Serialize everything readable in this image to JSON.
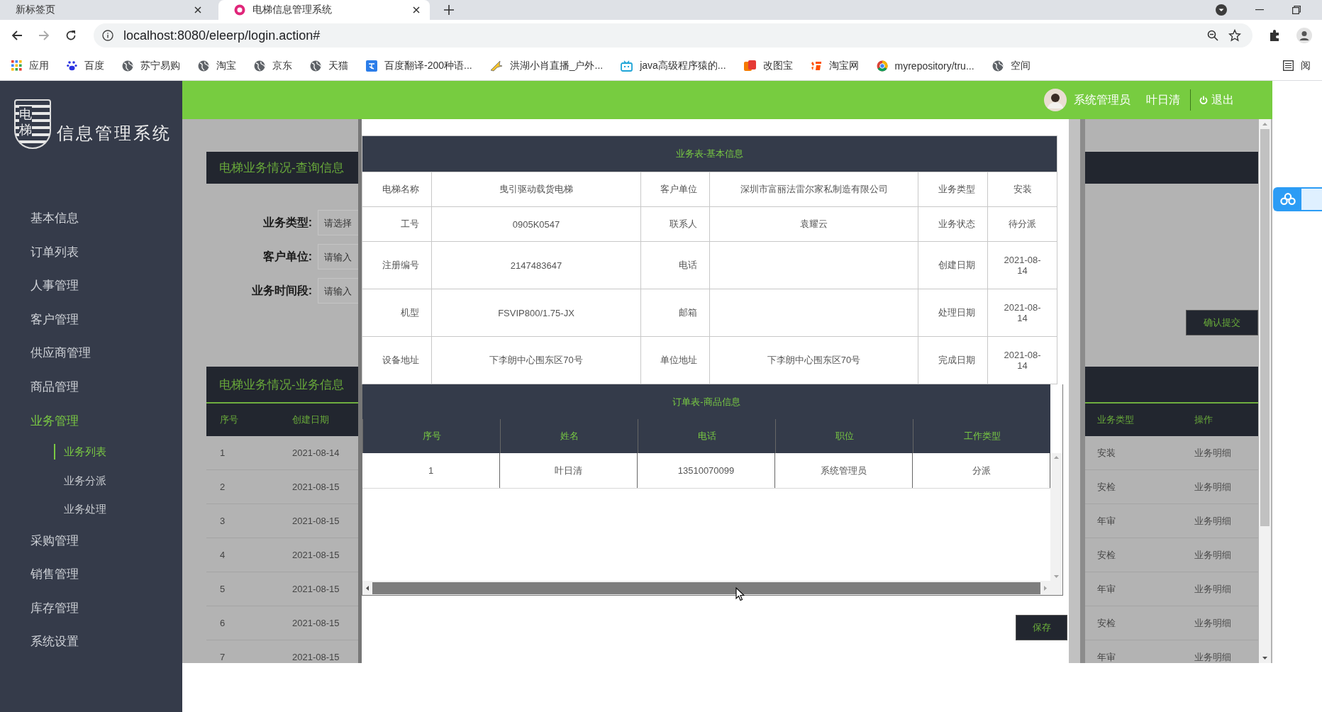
{
  "browser": {
    "tabs": [
      {
        "title": "新标签页",
        "selected": false
      },
      {
        "title": "电梯信息管理系统",
        "selected": true
      }
    ],
    "address": "localhost:8080/eleerp/login.action#",
    "bookmarks": [
      {
        "label": "应用"
      },
      {
        "label": "百度"
      },
      {
        "label": "苏宁易购"
      },
      {
        "label": "淘宝"
      },
      {
        "label": "京东"
      },
      {
        "label": "天猫"
      },
      {
        "label": "百度翻译-200种语..."
      },
      {
        "label": "洪湖小肖直播_户外..."
      },
      {
        "label": "java高级程序猿的..."
      },
      {
        "label": "改图宝"
      },
      {
        "label": "淘宝网"
      },
      {
        "label": "myrepository/tru..."
      },
      {
        "label": "空间"
      }
    ],
    "reading_list": "阅"
  },
  "header": {
    "role": "系统管理员",
    "user": "叶日清",
    "logout": "退出"
  },
  "sidebar": {
    "logo_badge": [
      "电",
      "梯"
    ],
    "logo_text": "信息管理系统",
    "items": [
      {
        "label": "基本信息",
        "selected": false
      },
      {
        "label": "订单列表",
        "selected": false
      },
      {
        "label": "人事管理",
        "selected": false
      },
      {
        "label": "客户管理",
        "selected": false
      },
      {
        "label": "供应商管理",
        "selected": false
      },
      {
        "label": "商品管理",
        "selected": false
      },
      {
        "label": "业务管理",
        "selected": true,
        "children": [
          {
            "label": "业务列表",
            "selected": true
          },
          {
            "label": "业务分派",
            "selected": false
          },
          {
            "label": "业务处理",
            "selected": false
          }
        ]
      },
      {
        "label": "采购管理",
        "selected": false
      },
      {
        "label": "销售管理",
        "selected": false
      },
      {
        "label": "库存管理",
        "selected": false
      },
      {
        "label": "系统设置",
        "selected": false
      }
    ]
  },
  "query": {
    "title": "电梯业务情况-查询信息",
    "fields": [
      {
        "label": "业务类型:",
        "placeholder": "请选择"
      },
      {
        "label": "客户单位:",
        "placeholder": "请输入"
      },
      {
        "label": "业务时间段:",
        "placeholder": "请输入"
      }
    ],
    "submit": "确认提交"
  },
  "business": {
    "title": "电梯业务情况-业务信息",
    "columns": [
      "序号",
      "创建日期",
      "业务类型",
      "操作"
    ],
    "rows": [
      [
        "1",
        "2021-08-14",
        "安装",
        "业务明细"
      ],
      [
        "2",
        "2021-08-15",
        "安检",
        "业务明细"
      ],
      [
        "3",
        "2021-08-15",
        "年审",
        "业务明细"
      ],
      [
        "4",
        "2021-08-15",
        "安检",
        "业务明细"
      ],
      [
        "5",
        "2021-08-15",
        "年审",
        "业务明细"
      ],
      [
        "6",
        "2021-08-15",
        "安检",
        "业务明细"
      ],
      [
        "7",
        "2021-08-15",
        "年审",
        "业务明细"
      ]
    ]
  },
  "modal": {
    "basic": {
      "title": "业务表-基本信息",
      "rows": [
        [
          "电梯名称",
          "曳引驱动载货电梯",
          "客户单位",
          "深圳市富丽法雷尔家私制造有限公司",
          "业务类型",
          "安装"
        ],
        [
          "工号",
          "0905K0547",
          "联系人",
          "袁耀云",
          "业务状态",
          "待分派"
        ],
        [
          "注册编号",
          "2147483647",
          "电话",
          "",
          "创建日期",
          "2021-08-14"
        ],
        [
          "机型",
          "FSVIP800/1.75-JX",
          "邮箱",
          "",
          "处理日期",
          "2021-08-14"
        ],
        [
          "设备地址",
          "下李朗中心围东区70号",
          "单位地址",
          "下李朗中心围东区70号",
          "完成日期",
          "2021-08-14"
        ]
      ]
    },
    "order": {
      "title": "订单表-商品信息",
      "columns": [
        "序号",
        "姓名",
        "电话",
        "职位",
        "工作类型"
      ],
      "rows": [
        [
          "1",
          "叶日清",
          "13510070099",
          "系统管理员",
          "分派"
        ]
      ]
    },
    "save": "保存"
  }
}
